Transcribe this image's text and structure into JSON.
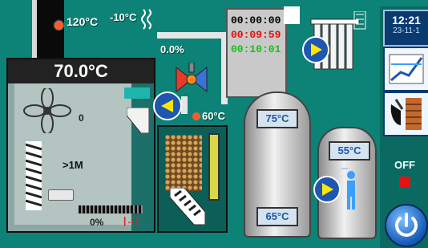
{
  "colors": {
    "background": "#0d8276",
    "hot_dot": "#ff5a2a",
    "timer_black": "#000000",
    "timer_red": "#e01010",
    "timer_green": "#18c018",
    "tank_label_text": "#1a57a8",
    "off_led": "#e81010"
  },
  "flue": {
    "temperature": "120°C"
  },
  "outdoor": {
    "temperature": "-10°C",
    "icon": "heat-waves-icon"
  },
  "boiler": {
    "temperature": "70.0°C",
    "fan_value": "0",
    "feeder_value": ">1M",
    "power_value": "0%",
    "range_icon": "range-arrows-icon"
  },
  "mixing_valve": {
    "opening": "0.0%",
    "return_temperature": "60°C"
  },
  "timers": [
    "00:00:00",
    "00:09:59",
    "00:10:01"
  ],
  "buffer_tank": {
    "top_temperature": "75°C",
    "bottom_temperature": "65°C"
  },
  "dhw_tank": {
    "temperature": "55°C"
  },
  "clock": {
    "time": "12:21",
    "date": "23-11-1"
  },
  "status": {
    "label": "OFF"
  },
  "icons": {
    "moon": "moon-icon",
    "radiator": "radiator-icon",
    "chart": "chart-icon",
    "fuel": "fuel-icon",
    "power": "power-icon"
  }
}
